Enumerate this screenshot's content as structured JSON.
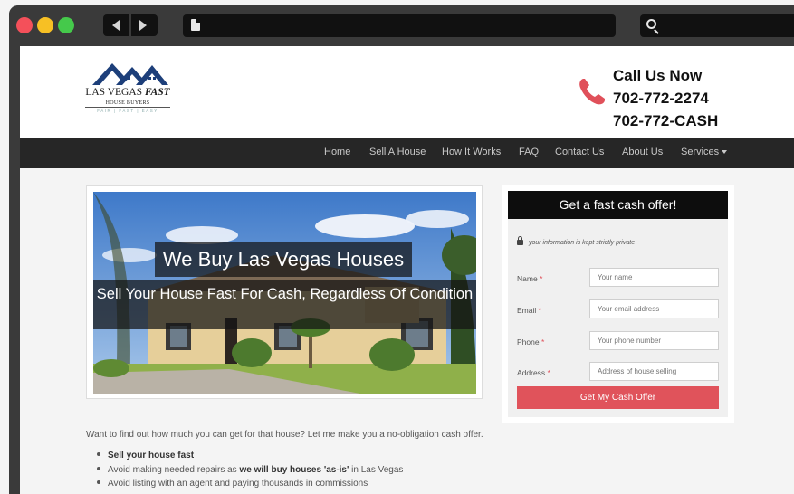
{
  "browser": {
    "window_controls": [
      "close",
      "minimize",
      "maximize"
    ],
    "nav_icons": [
      "back-arrow-icon",
      "forward-arrow-icon"
    ],
    "address_icon": "page-icon",
    "search_icon": "search-icon"
  },
  "logo": {
    "line1": "LAS VEGAS",
    "line1_em": "FAST",
    "line2": "HOUSE BUYERS",
    "tagline": "FAIR | FAST | EASY"
  },
  "contact": {
    "heading": "Call Us Now",
    "phone1": "702-772-2274",
    "phone2": "702-772-CASH",
    "icon": "phone-icon",
    "icon_color": "#e0505a"
  },
  "nav": {
    "items": [
      {
        "label": "Home"
      },
      {
        "label": "Sell A House"
      },
      {
        "label": "How It Works"
      },
      {
        "label": "FAQ"
      },
      {
        "label": "Contact Us"
      },
      {
        "label": "About Us"
      },
      {
        "label": "Services"
      }
    ]
  },
  "hero": {
    "title": "We Buy Las Vegas Houses",
    "subtitle": "Sell Your House Fast For Cash, Regardless Of Condition"
  },
  "form": {
    "heading": "Get a fast cash offer!",
    "privacy_note": "your information is kept strictly private",
    "fields": [
      {
        "label": "Name",
        "placeholder": "Your name"
      },
      {
        "label": "Email",
        "placeholder": "Your email address"
      },
      {
        "label": "Phone",
        "placeholder": "Your phone number"
      },
      {
        "label": "Address",
        "placeholder": "Address of house selling"
      }
    ],
    "required_mark": "*",
    "submit_label": "Get My Cash Offer",
    "accent_color": "#e0535b"
  },
  "content": {
    "intro": "Want to find out how much you can get for that house? Let me make you a no-obligation cash offer.",
    "bullets": [
      {
        "pre": "",
        "bold": "Sell your house fast",
        "post": ""
      },
      {
        "pre": "Avoid making needed repairs as ",
        "bold": "we will buy houses 'as-is'",
        "post": " in Las Vegas"
      },
      {
        "pre": "Avoid listing with an agent and paying thousands in commissions",
        "bold": "",
        "post": ""
      }
    ]
  }
}
